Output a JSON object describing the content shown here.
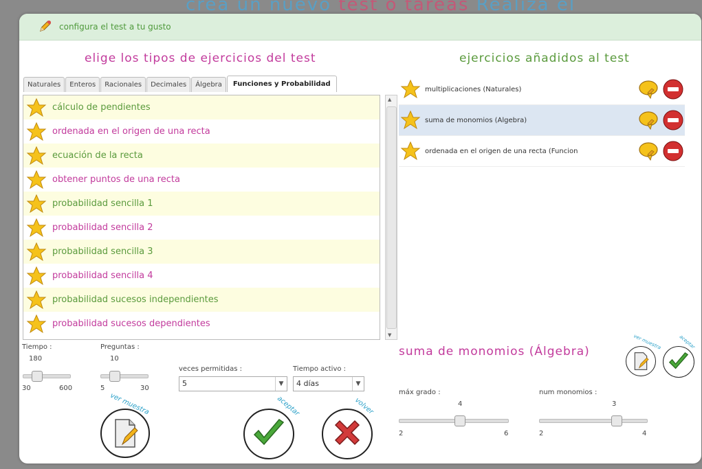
{
  "background_title": {
    "part1": "crea un nuevo ",
    "part2": "test o tareas",
    "part3": " Realiza el"
  },
  "header": {
    "title": "configura el test a tu gusto",
    "icon": "pencil-icon"
  },
  "left_heading": "elige los tipos de ejercicios del test",
  "right_heading": "ejercicios añadidos al test",
  "tabs": [
    "Naturales",
    "Enteros",
    "Racionales",
    "Decimales",
    "Álgebra",
    "Funciones y Probabilidad"
  ],
  "active_tab": "Funciones y Probabilidad",
  "exercises": [
    {
      "label": "cálculo de pendientes",
      "color": "#5a9a3c"
    },
    {
      "label": "ordenada en el origen de una recta",
      "color": "#c23a9c"
    },
    {
      "label": "ecuación de la recta",
      "color": "#5a9a3c"
    },
    {
      "label": "obtener puntos de una recta",
      "color": "#c23a9c"
    },
    {
      "label": "probabilidad sencilla 1",
      "color": "#5a9a3c"
    },
    {
      "label": "probabilidad sencilla 2",
      "color": "#c23a9c"
    },
    {
      "label": "probabilidad sencilla 3",
      "color": "#5a9a3c"
    },
    {
      "label": "probabilidad sencilla 4",
      "color": "#c23a9c"
    },
    {
      "label": "probabilidad sucesos independientes",
      "color": "#5a9a3c"
    },
    {
      "label": "probabilidad sucesos dependientes",
      "color": "#c23a9c"
    }
  ],
  "added": [
    {
      "label": "multiplicaciones (Naturales)",
      "selected": false
    },
    {
      "label": "suma de monomios (Álgebra)",
      "selected": true
    },
    {
      "label": "ordenada en el origen de una recta (Funcion",
      "selected": false
    }
  ],
  "controls": {
    "tiempo": {
      "label": "Tiempo :",
      "value": "180",
      "min": "30",
      "max": "600"
    },
    "preguntas": {
      "label": "Preguntas :",
      "value": "10",
      "min": "5",
      "max": "30"
    },
    "veces": {
      "label": "veces permitidas :",
      "value": "5"
    },
    "tiempo_activo": {
      "label": "Tiempo activo :",
      "value": "4 días"
    }
  },
  "buttons": {
    "ver_muestra": "ver muestra",
    "aceptar": "aceptar",
    "volver": "volver"
  },
  "detail": {
    "title": "suma de monomios (Álgebra)",
    "max_grado": {
      "label": "máx grado :",
      "value": "4",
      "min": "2",
      "max": "6"
    },
    "num_monomios": {
      "label": "num monomios :",
      "value": "3",
      "min": "2",
      "max": "4"
    },
    "ver_muestra": "ver muestra",
    "aceptar": "aceptar"
  }
}
